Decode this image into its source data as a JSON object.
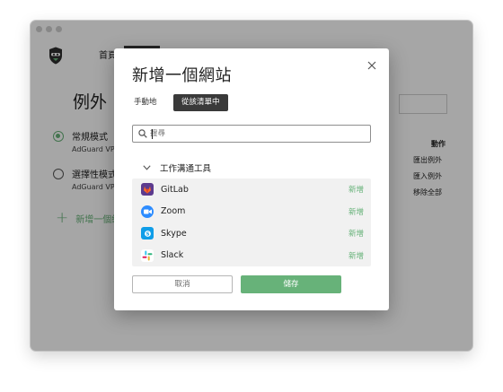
{
  "app": {
    "tab_home": "首頁",
    "page_title": "例外",
    "modes": [
      {
        "title": "常規模式",
        "subtitle": "AdGuard VPN",
        "selected": true
      },
      {
        "title": "選擇性模式",
        "subtitle": "AdGuard VPN",
        "selected": false
      }
    ],
    "add_site_label": "新增一個網站",
    "actions_header": "動作",
    "actions": [
      "匯出例外",
      "匯入例外",
      "移除全部"
    ],
    "accent_color": "#67b279"
  },
  "modal": {
    "title": "新增一個網站",
    "tabs": [
      {
        "label": "手動地",
        "active": false
      },
      {
        "label": "從該清單中",
        "active": true
      }
    ],
    "search": {
      "placeholder": "搜尋",
      "value": ""
    },
    "group": {
      "label": "工作溝通工具",
      "expanded": true
    },
    "sites": [
      {
        "name": "GitLab",
        "icon": "gitlab-icon",
        "action": "新增"
      },
      {
        "name": "Zoom",
        "icon": "zoom-icon",
        "action": "新增"
      },
      {
        "name": "Skype",
        "icon": "skype-icon",
        "action": "新增"
      },
      {
        "name": "Slack",
        "icon": "slack-icon",
        "action": "新增"
      }
    ],
    "cancel_label": "取消",
    "save_label": "儲存"
  }
}
